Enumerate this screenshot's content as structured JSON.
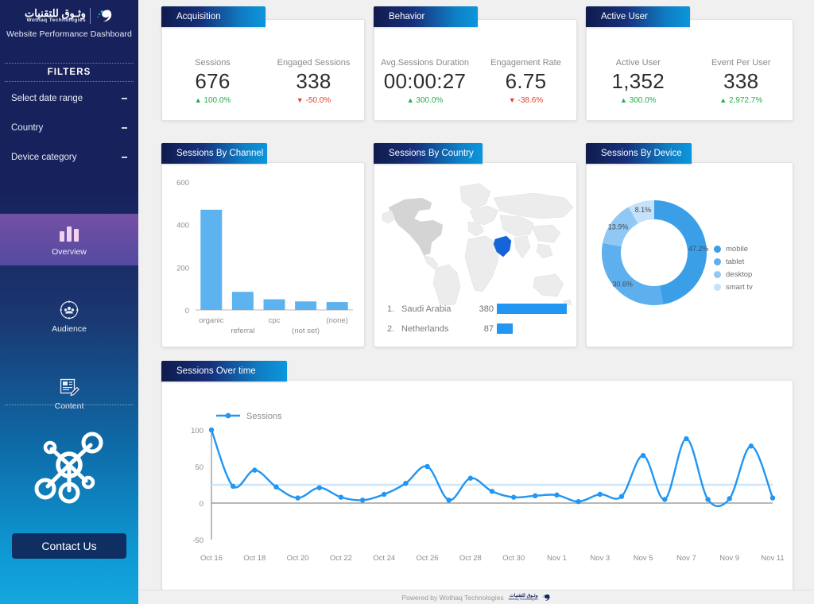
{
  "sidebar": {
    "brand": {
      "arabic": "وثـوق للتقنيات",
      "english": "Wothaq Technologies",
      "subtitle": "Website Performance Dashboard",
      "logo_icon": "swirl-logo-icon"
    },
    "filters_title": "FILTERS",
    "filters": [
      {
        "label": "Select date range",
        "icon": "chevron-down-icon"
      },
      {
        "label": "Country",
        "icon": "chevron-down-icon"
      },
      {
        "label": "Device category",
        "icon": "chevron-down-icon"
      }
    ],
    "nav": [
      {
        "label": "Overview",
        "icon": "bar-chart-icon",
        "active": true
      },
      {
        "label": "Audience",
        "icon": "audience-icon",
        "active": false
      },
      {
        "label": "Content",
        "icon": "content-edit-icon",
        "active": false
      }
    ],
    "hub_icon": "network-hub-icon",
    "contact_button": "Contact Us"
  },
  "kpi_cards": [
    {
      "title": "Acquisition",
      "metrics": [
        {
          "label": "Sessions",
          "value": "676",
          "delta": "100.0%",
          "direction": "up",
          "arrow": "▲"
        },
        {
          "label": "Engaged Sessions",
          "value": "338",
          "delta": "-50.0%",
          "direction": "down",
          "arrow": "▼"
        }
      ]
    },
    {
      "title": "Behavior",
      "metrics": [
        {
          "label": "Avg.Sessions Duration",
          "value": "00:00:27",
          "delta": "300.0%",
          "direction": "up",
          "arrow": "▲"
        },
        {
          "label": "Engagement Rate",
          "value": "6.75",
          "delta": "-38.6%",
          "direction": "down",
          "arrow": "▼"
        }
      ]
    },
    {
      "title": "Active User",
      "metrics": [
        {
          "label": "Active User",
          "value": "1,352",
          "delta": "300.0%",
          "direction": "up",
          "arrow": "▲"
        },
        {
          "label": "Event Per User",
          "value": "338",
          "delta": "2,972.7%",
          "direction": "up",
          "arrow": "▲"
        }
      ]
    }
  ],
  "panels": {
    "channel_title": "Sessions By Channel",
    "country_title": "Sessions By Country",
    "device_title": "Sessions By Device",
    "timeseries_title": "Sessions Over time"
  },
  "country_list": [
    {
      "rank": "1.",
      "name": "Saudi Arabia",
      "value": "380",
      "pct": 100
    },
    {
      "rank": "2.",
      "name": "Netherlands",
      "value": "87",
      "pct": 22.9
    }
  ],
  "footer": {
    "text": "Powered by Wothaq Technologies",
    "logo_arabic": "وثـوق للتقنيات",
    "logo_english": "Wothaq Technologies"
  },
  "colors": {
    "sidebar_top": "#17215c",
    "sidebar_bottom": "#16a6de",
    "tab_gradient_start": "#101b4d",
    "tab_gradient_end": "#0c96dd",
    "accent_blue": "#4aa8ef",
    "bar_blue": "#5cb3f0",
    "positive": "#1faf4b",
    "negative": "#e8402a",
    "active_nav": "#6d54a8",
    "map_highlight": "#1565d8",
    "map_base": "#ececec"
  },
  "chart_data": [
    {
      "type": "bar",
      "title": "Sessions By Channel",
      "categories": [
        "organic",
        "referral",
        "cpc",
        "(not set)",
        "(none)"
      ],
      "values": [
        470,
        85,
        50,
        40,
        37
      ],
      "xlabel": "",
      "ylabel": "",
      "ylim": [
        0,
        600
      ],
      "yticks": [
        0,
        200,
        400,
        600
      ],
      "grid": false,
      "bar_color": "#5cb3f0"
    },
    {
      "type": "bar",
      "title": "Sessions By Country",
      "categories": [
        "Saudi Arabia",
        "Netherlands"
      ],
      "values": [
        380,
        87
      ],
      "xlabel": "",
      "ylabel": "",
      "grid": false,
      "bar_color": "#2196f3",
      "map_highlight_country": "Saudi Arabia"
    },
    {
      "type": "pie",
      "title": "Sessions By Device",
      "labels": [
        "mobile",
        "tablet",
        "desktop",
        "smart tv"
      ],
      "values": [
        47.2,
        30.6,
        13.9,
        8.1
      ],
      "value_labels": [
        "47.2%",
        "30.6%",
        "13.9%",
        "8.1%"
      ],
      "colors": [
        "#3b9fe8",
        "#5dafee",
        "#8fc8f5",
        "#c5e2fa"
      ],
      "legend_position": "right",
      "donut": true
    },
    {
      "type": "line",
      "title": "Sessions Over time",
      "legend": [
        "Sessions"
      ],
      "x": [
        "Oct 16",
        "Oct 17",
        "Oct 18",
        "Oct 19",
        "Oct 20",
        "Oct 21",
        "Oct 22",
        "Oct 23",
        "Oct 24",
        "Oct 25",
        "Oct 26",
        "Oct 27",
        "Oct 28",
        "Oct 29",
        "Oct 30",
        "Oct 31",
        "Nov 1",
        "Nov 2",
        "Nov 3",
        "Nov 4",
        "Nov 5",
        "Nov 6",
        "Nov 7",
        "Nov 8",
        "Nov 9",
        "Nov 10",
        "Nov 11"
      ],
      "xtick_labels": [
        "Oct 16",
        "Oct 18",
        "Oct 20",
        "Oct 22",
        "Oct 24",
        "Oct 26",
        "Oct 28",
        "Oct 30",
        "Nov 1",
        "Nov 3",
        "Nov 5",
        "Nov 7",
        "Nov 9",
        "Nov 11"
      ],
      "series": [
        {
          "name": "Sessions",
          "values": [
            100,
            23,
            45,
            22,
            7,
            21,
            8,
            4,
            12,
            27,
            50,
            4,
            34,
            16,
            8,
            10,
            11,
            2,
            12,
            9,
            65,
            5,
            88,
            5,
            6,
            78,
            7
          ]
        }
      ],
      "ylim": [
        -50,
        100
      ],
      "yticks": [
        -50,
        0,
        50,
        100
      ],
      "line_color": "#2196f3",
      "reference_line": 25,
      "grid": false
    }
  ]
}
